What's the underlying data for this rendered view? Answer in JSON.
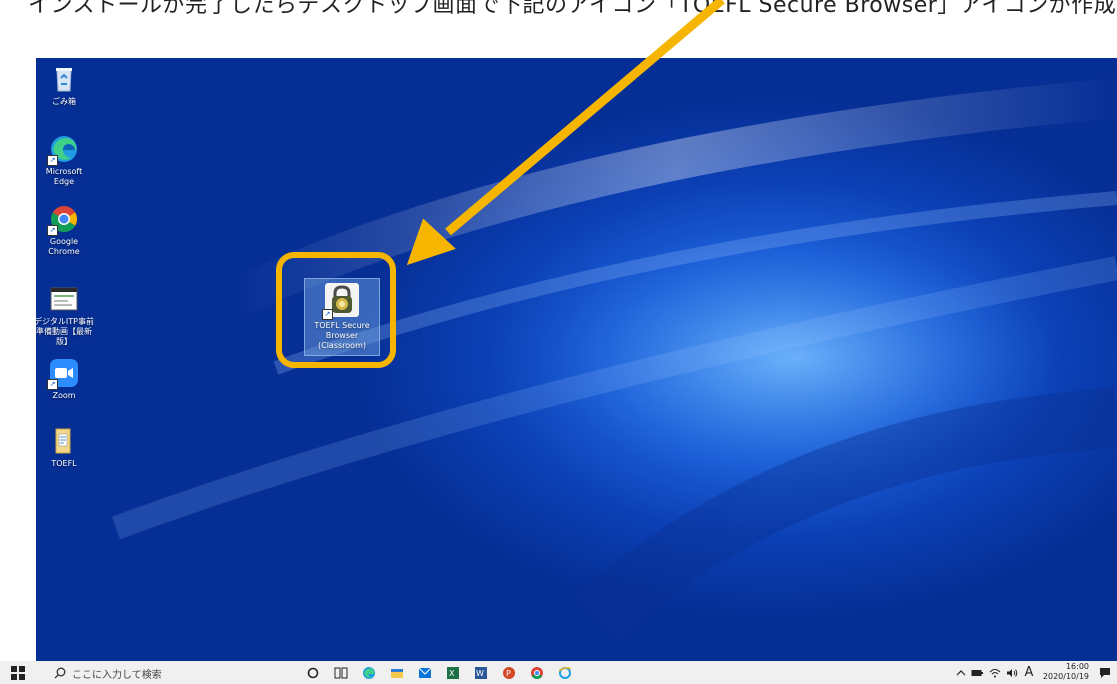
{
  "caption": {
    "text": "インストールが完了したらデスクトップ画面で下記のアイコン「TOEFL Secure Browser」アイコンが作成されています"
  },
  "desktop": {
    "icons": [
      {
        "label": "ごみ箱",
        "icon": "recycle-bin-icon"
      },
      {
        "label": "Microsoft Edge",
        "icon": "edge-icon"
      },
      {
        "label": "Google Chrome",
        "icon": "chrome-icon"
      },
      {
        "label": "デジタルITP事前準備動画【最新版】",
        "icon": "video-file-icon"
      },
      {
        "label": "Zoom",
        "icon": "zoom-icon"
      },
      {
        "label": "TOEFL",
        "icon": "folder-icon"
      }
    ],
    "selected": {
      "label": "TOEFL Secure Browser (Classroom)",
      "icon": "lock-icon"
    }
  },
  "taskbar": {
    "search_placeholder": "ここに入力して検索",
    "ime": "A",
    "time": "16:00",
    "date": "2020/10/19"
  },
  "colors": {
    "highlight": "#f5b500",
    "arrow": "#f5b500",
    "taskbar": "#f0f0f0"
  }
}
